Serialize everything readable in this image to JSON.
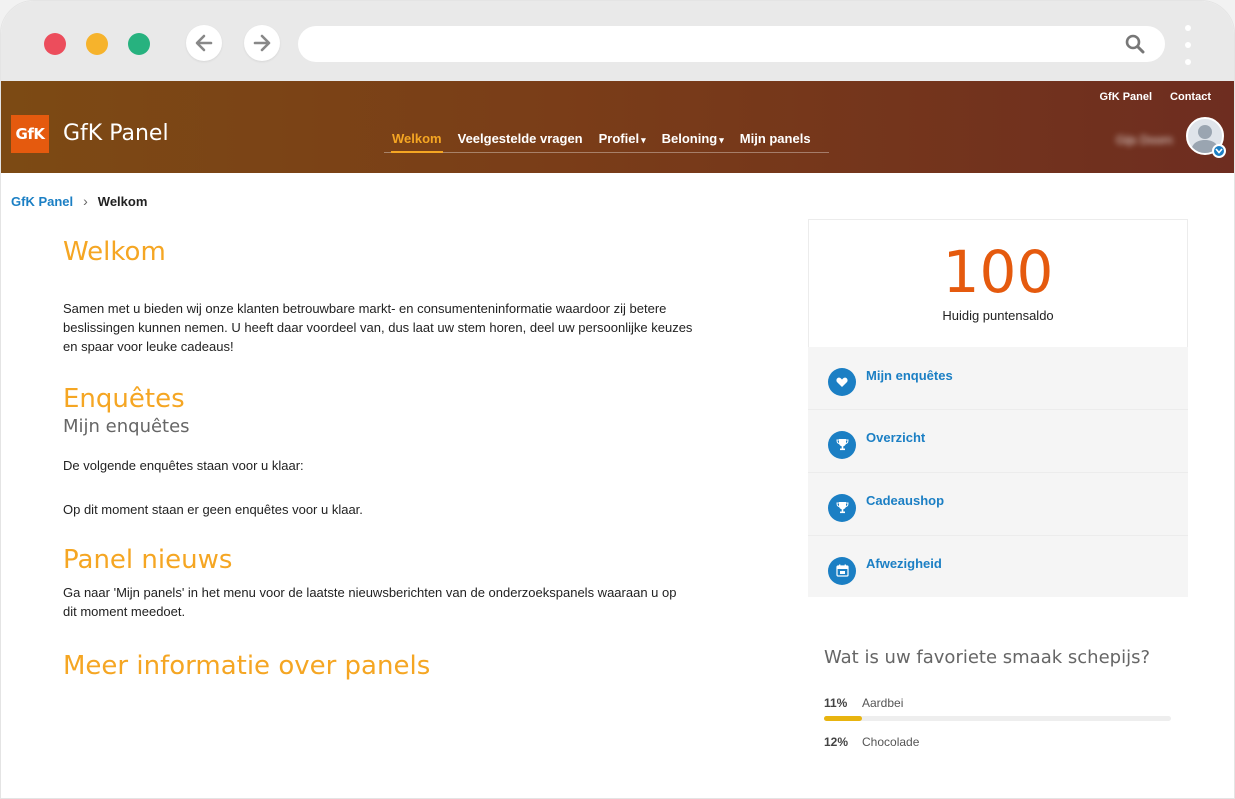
{
  "header": {
    "logo_text": "GfK",
    "brand": "GfK Panel",
    "top_links": [
      "GfK Panel",
      "Contact"
    ],
    "nav": [
      {
        "label": "Welkom",
        "active": true,
        "caret": false
      },
      {
        "label": "Veelgestelde vragen",
        "active": false,
        "caret": false
      },
      {
        "label": "Profiel",
        "active": false,
        "caret": true
      },
      {
        "label": "Beloning",
        "active": false,
        "caret": true
      },
      {
        "label": "Mijn panels",
        "active": false,
        "caret": false
      }
    ],
    "username": "Gijs Doorn",
    "caret_glyph": "▾"
  },
  "breadcrumb": {
    "root": "GfK Panel",
    "separator": "›",
    "current": "Welkom"
  },
  "main": {
    "welcome_title": "Welkom",
    "welcome_text": "Samen met u bieden wij onze klanten betrouwbare markt- en consumenteninformatie waardoor zij betere beslissingen kunnen nemen. U heeft daar voordeel van, dus laat uw stem horen, deel uw persoonlijke keuzes en spaar voor leuke cadeaus!",
    "surveys_title": "Enquêtes",
    "surveys_subtitle": "Mijn enquêtes",
    "surveys_intro": "De volgende enquêtes staan voor u klaar:",
    "surveys_empty": "Op dit moment staan er geen enquêtes voor u klaar.",
    "news_title": "Panel nieuws",
    "news_text": "Ga naar 'Mijn panels' in het menu voor de laatste nieuwsberichten van de onderzoekspanels waaraan u op dit moment meedoet.",
    "more_title": "Meer informatie over panels"
  },
  "sidebar": {
    "points_value": "100",
    "points_label": "Huidig puntensaldo",
    "menu": [
      {
        "label": "Mijn enquêtes",
        "icon": "heart-icon"
      },
      {
        "label": "Overzicht",
        "icon": "trophy-icon"
      },
      {
        "label": "Cadeaushop",
        "icon": "trophy-icon"
      },
      {
        "label": "Afwezigheid",
        "icon": "calendar-icon"
      }
    ]
  },
  "poll": {
    "question": "Wat is uw favoriete smaak schepijs?",
    "options": [
      {
        "pct": "11%",
        "label": "Aardbei",
        "value": 0.11
      },
      {
        "pct": "12%",
        "label": "Chocolade",
        "value": 0.12
      }
    ]
  },
  "colors": {
    "accent": "#f5a623",
    "link": "#1b7fc4",
    "points": "#e55a0e",
    "poll_bar": "#e8b40f"
  }
}
